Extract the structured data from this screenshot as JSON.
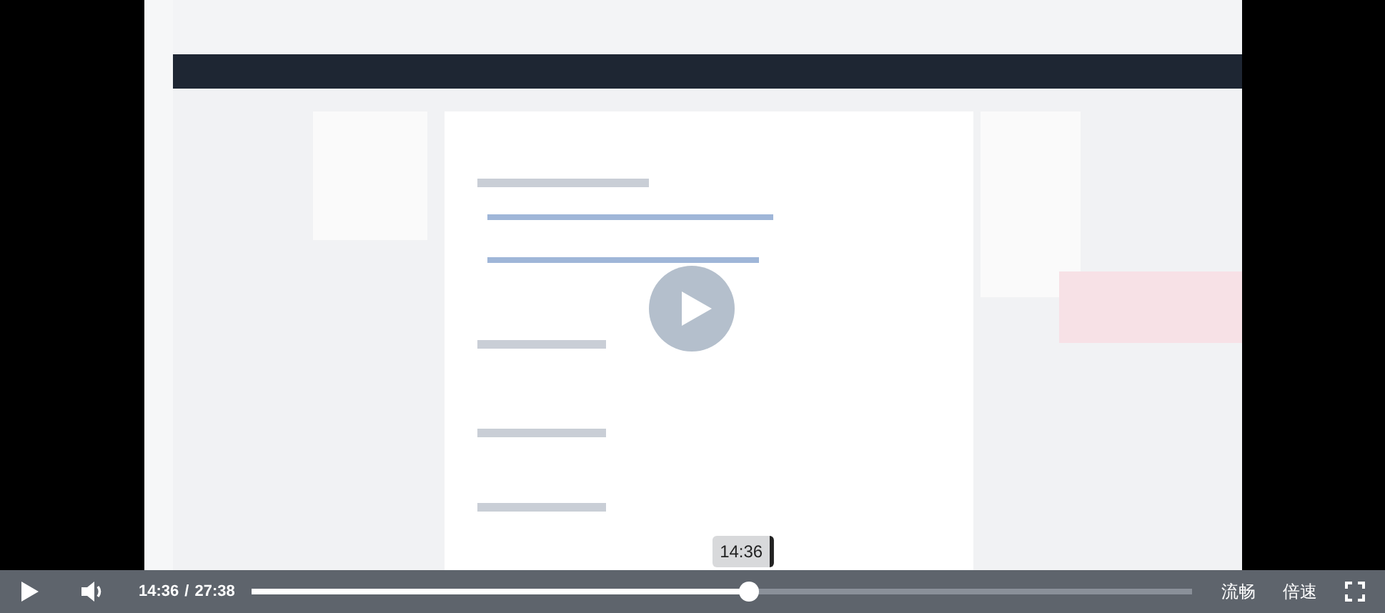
{
  "player": {
    "playing": false,
    "current_time": "14:36",
    "separator": "/",
    "duration": "27:38",
    "progress": {
      "level": 0.529
    },
    "tooltip": "14:36",
    "quality": "流畅",
    "speed": "倍速"
  }
}
